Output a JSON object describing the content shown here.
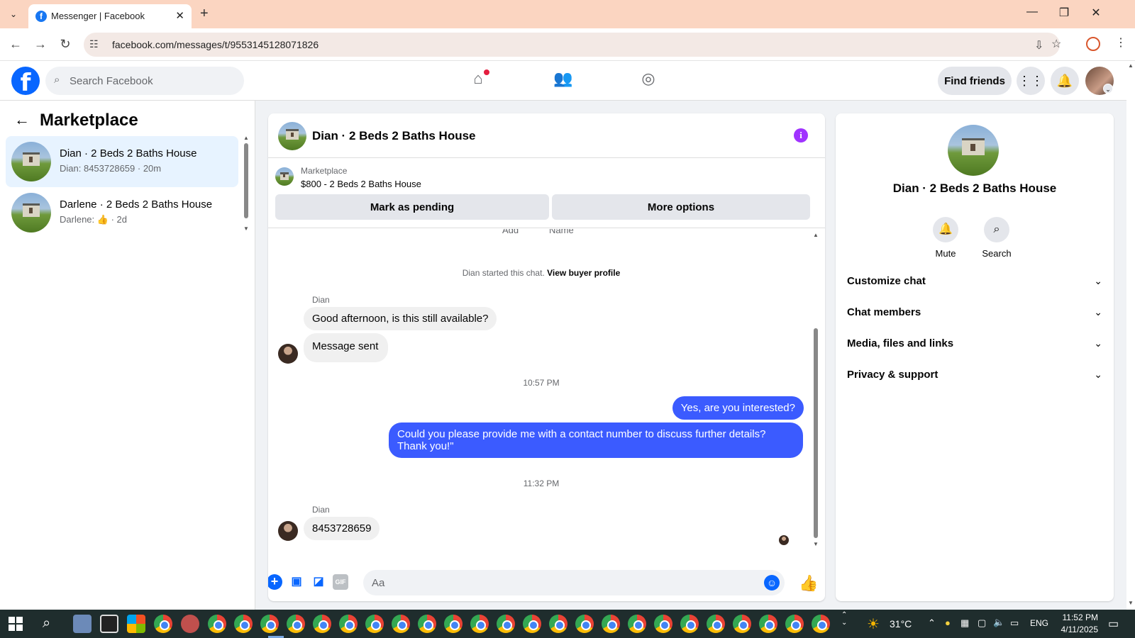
{
  "browser": {
    "tab_title": "Messenger | Facebook",
    "url": "facebook.com/messages/t/9553145128071826"
  },
  "fb_header": {
    "search_placeholder": "Search Facebook",
    "find_friends_label": "Find friends"
  },
  "sidebar": {
    "title": "Marketplace",
    "conversations": [
      {
        "name": "Dian · 2 Beds 2 Baths House",
        "preview": "Dian: 8453728659 · 20m"
      },
      {
        "name": "Darlene · 2 Beds 2 Baths House",
        "preview_prefix": "Darlene:",
        "preview_icon": "thumbs-up-icon",
        "preview_suffix": "· 2d"
      }
    ]
  },
  "chat": {
    "title": "Dian · 2 Beds 2 Baths House",
    "marketplace_label": "Marketplace",
    "listing": "$800 - 2 Beds 2 Baths House",
    "mark_pending_label": "Mark as pending",
    "more_options_label": "More options",
    "cut_off_labels": [
      "Add",
      "Name"
    ],
    "started_text": "Dian started this chat.",
    "view_buyer_profile": "View buyer profile",
    "messages": [
      {
        "sender_label": "Dian",
        "text": "Good afternoon, is this still available?"
      },
      {
        "text": "Message sent"
      },
      {
        "timestamp": "10:57 PM"
      },
      {
        "text": "Yes, are you interested?"
      },
      {
        "text": "Could you please provide me with a contact number to discuss further details? Thank you!\""
      },
      {
        "timestamp": "11:32 PM"
      },
      {
        "sender_label": "Dian",
        "text": "8453728659"
      }
    ],
    "composer_placeholder": "Aa",
    "composer_gif_label": "GIF"
  },
  "details": {
    "name": "Dian · 2 Beds 2 Baths House",
    "actions": [
      {
        "label": "Mute",
        "icon": "bell-icon"
      },
      {
        "label": "Search",
        "icon": "search-icon"
      }
    ],
    "sections": [
      "Customize chat",
      "Chat members",
      "Media, files and links",
      "Privacy & support"
    ]
  },
  "taskbar": {
    "temperature": "31°C",
    "language": "ENG",
    "time": "11:52 PM",
    "date": "4/11/2025"
  },
  "colors": {
    "outgoing_bubble": "#3b5bff",
    "fb_blue": "#0866ff",
    "info_purple": "#a033ff",
    "tab_bar": "#fbd5c1"
  }
}
